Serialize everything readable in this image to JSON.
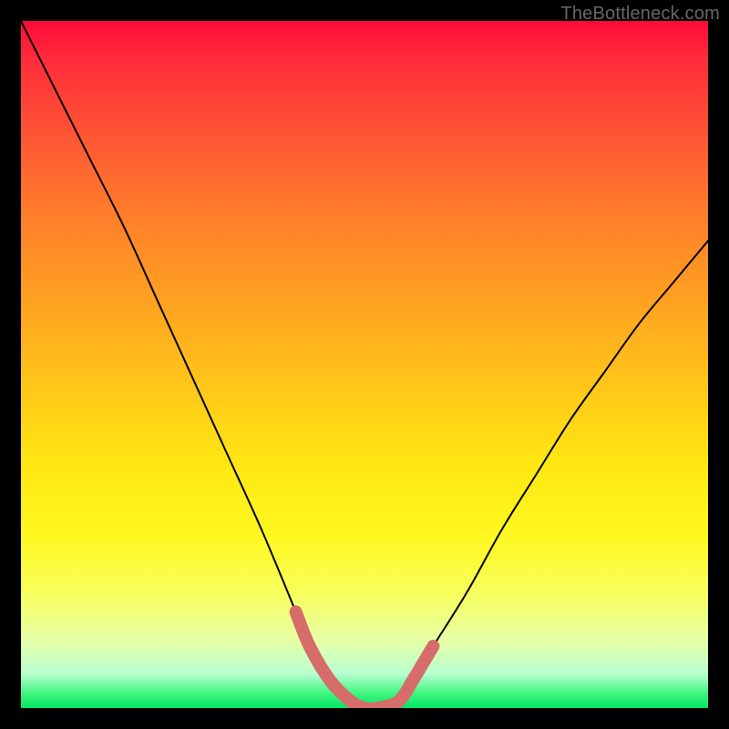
{
  "watermark": "TheBottleneck.com",
  "chart_data": {
    "type": "line",
    "title": "",
    "xlabel": "",
    "ylabel": "",
    "xlim": [
      0,
      100
    ],
    "ylim": [
      0,
      100
    ],
    "series": [
      {
        "name": "bottleneck-curve",
        "x": [
          0,
          5,
          10,
          15,
          20,
          25,
          30,
          35,
          40,
          42,
          45,
          48,
          50,
          52,
          55,
          57,
          60,
          65,
          70,
          75,
          80,
          85,
          90,
          95,
          100
        ],
        "values": [
          100,
          90,
          80,
          70,
          59,
          48,
          37,
          26,
          14,
          9,
          4,
          1,
          0,
          0,
          1,
          4,
          9,
          17,
          26,
          34,
          42,
          49,
          56,
          62,
          68
        ]
      },
      {
        "name": "highlight-segment",
        "x": [
          40,
          42,
          45,
          48,
          50,
          52,
          55,
          57,
          60
        ],
        "values": [
          14,
          9,
          4,
          1,
          0,
          0,
          1,
          4,
          9
        ]
      }
    ],
    "colors": {
      "curve": "#000000",
      "highlight": "#d66d6b",
      "gradient_top": "#ff0b3a",
      "gradient_bottom": "#00e765"
    }
  }
}
